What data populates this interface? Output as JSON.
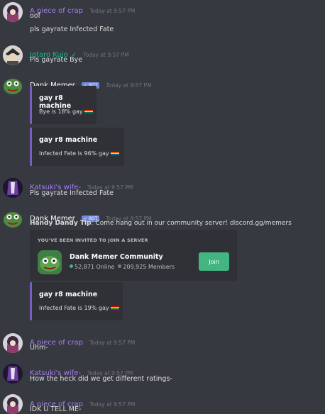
{
  "colors": {
    "background": "#36393f",
    "embed_bg": "#2f3136",
    "embed_border": "#7a5ec1",
    "bot_badge": "#7289da",
    "join_button": "#43b581",
    "online_dot": "#43b581",
    "members_dot": "#747f8d",
    "author_purple": "#a77df5",
    "author_green": "#1abc9c",
    "author_white": "#ffffff"
  },
  "messages": [
    {
      "author": "A piece of crap",
      "timestamp": "Today at 9:57 PM",
      "lines": [
        "oof",
        "pls gayrate Infected Fate"
      ]
    },
    {
      "author": "Jotaro Kujo",
      "verified_icon": "check-icon",
      "timestamp": "Today at 9:57 PM",
      "lines": [
        "Pls gayrate Bye"
      ]
    },
    {
      "author": "Dank Memer",
      "bot_badge": "✓ BOT",
      "timestamp": "Today at 9:57 PM",
      "embeds": [
        {
          "title": "gay r8 machine",
          "description": "Bye is 18% gay"
        },
        {
          "title": "gay r8 machine",
          "description": "Infected Fate is 96% gay"
        }
      ]
    },
    {
      "author": "Katsuki's wife-",
      "timestamp": "Today at 9:57 PM",
      "lines": [
        "Pls gayrate Infected Fate"
      ]
    },
    {
      "author": "Dank Memer",
      "bot_badge": "✓ BOT",
      "timestamp": "Today at 9:57 PM",
      "tip_label": "Handy Dandy Tip",
      "tip_text": ": Come hang out in our community server! discord.gg/memers",
      "invite": {
        "header": "YOU'VE BEEN INVITED TO JOIN A SERVER",
        "server_name": "Dank Memer Community",
        "online": "52,871 Online",
        "members": "209,925 Members",
        "join_label": "Join"
      },
      "embeds": [
        {
          "title": "gay r8 machine",
          "description": "Infected Fate is 19% gay"
        }
      ]
    },
    {
      "author": "A piece of crap",
      "timestamp": "Today at 9:57 PM",
      "lines": [
        "Uhm-"
      ]
    },
    {
      "author": "Katsuki's wife-",
      "timestamp": "Today at 9:57 PM",
      "lines": [
        "How the heck did we get different ratings-"
      ]
    },
    {
      "author": "A piece of crap",
      "timestamp": "Today at 9:57 PM",
      "lines": [
        "IDK U TELL ME-"
      ]
    }
  ]
}
